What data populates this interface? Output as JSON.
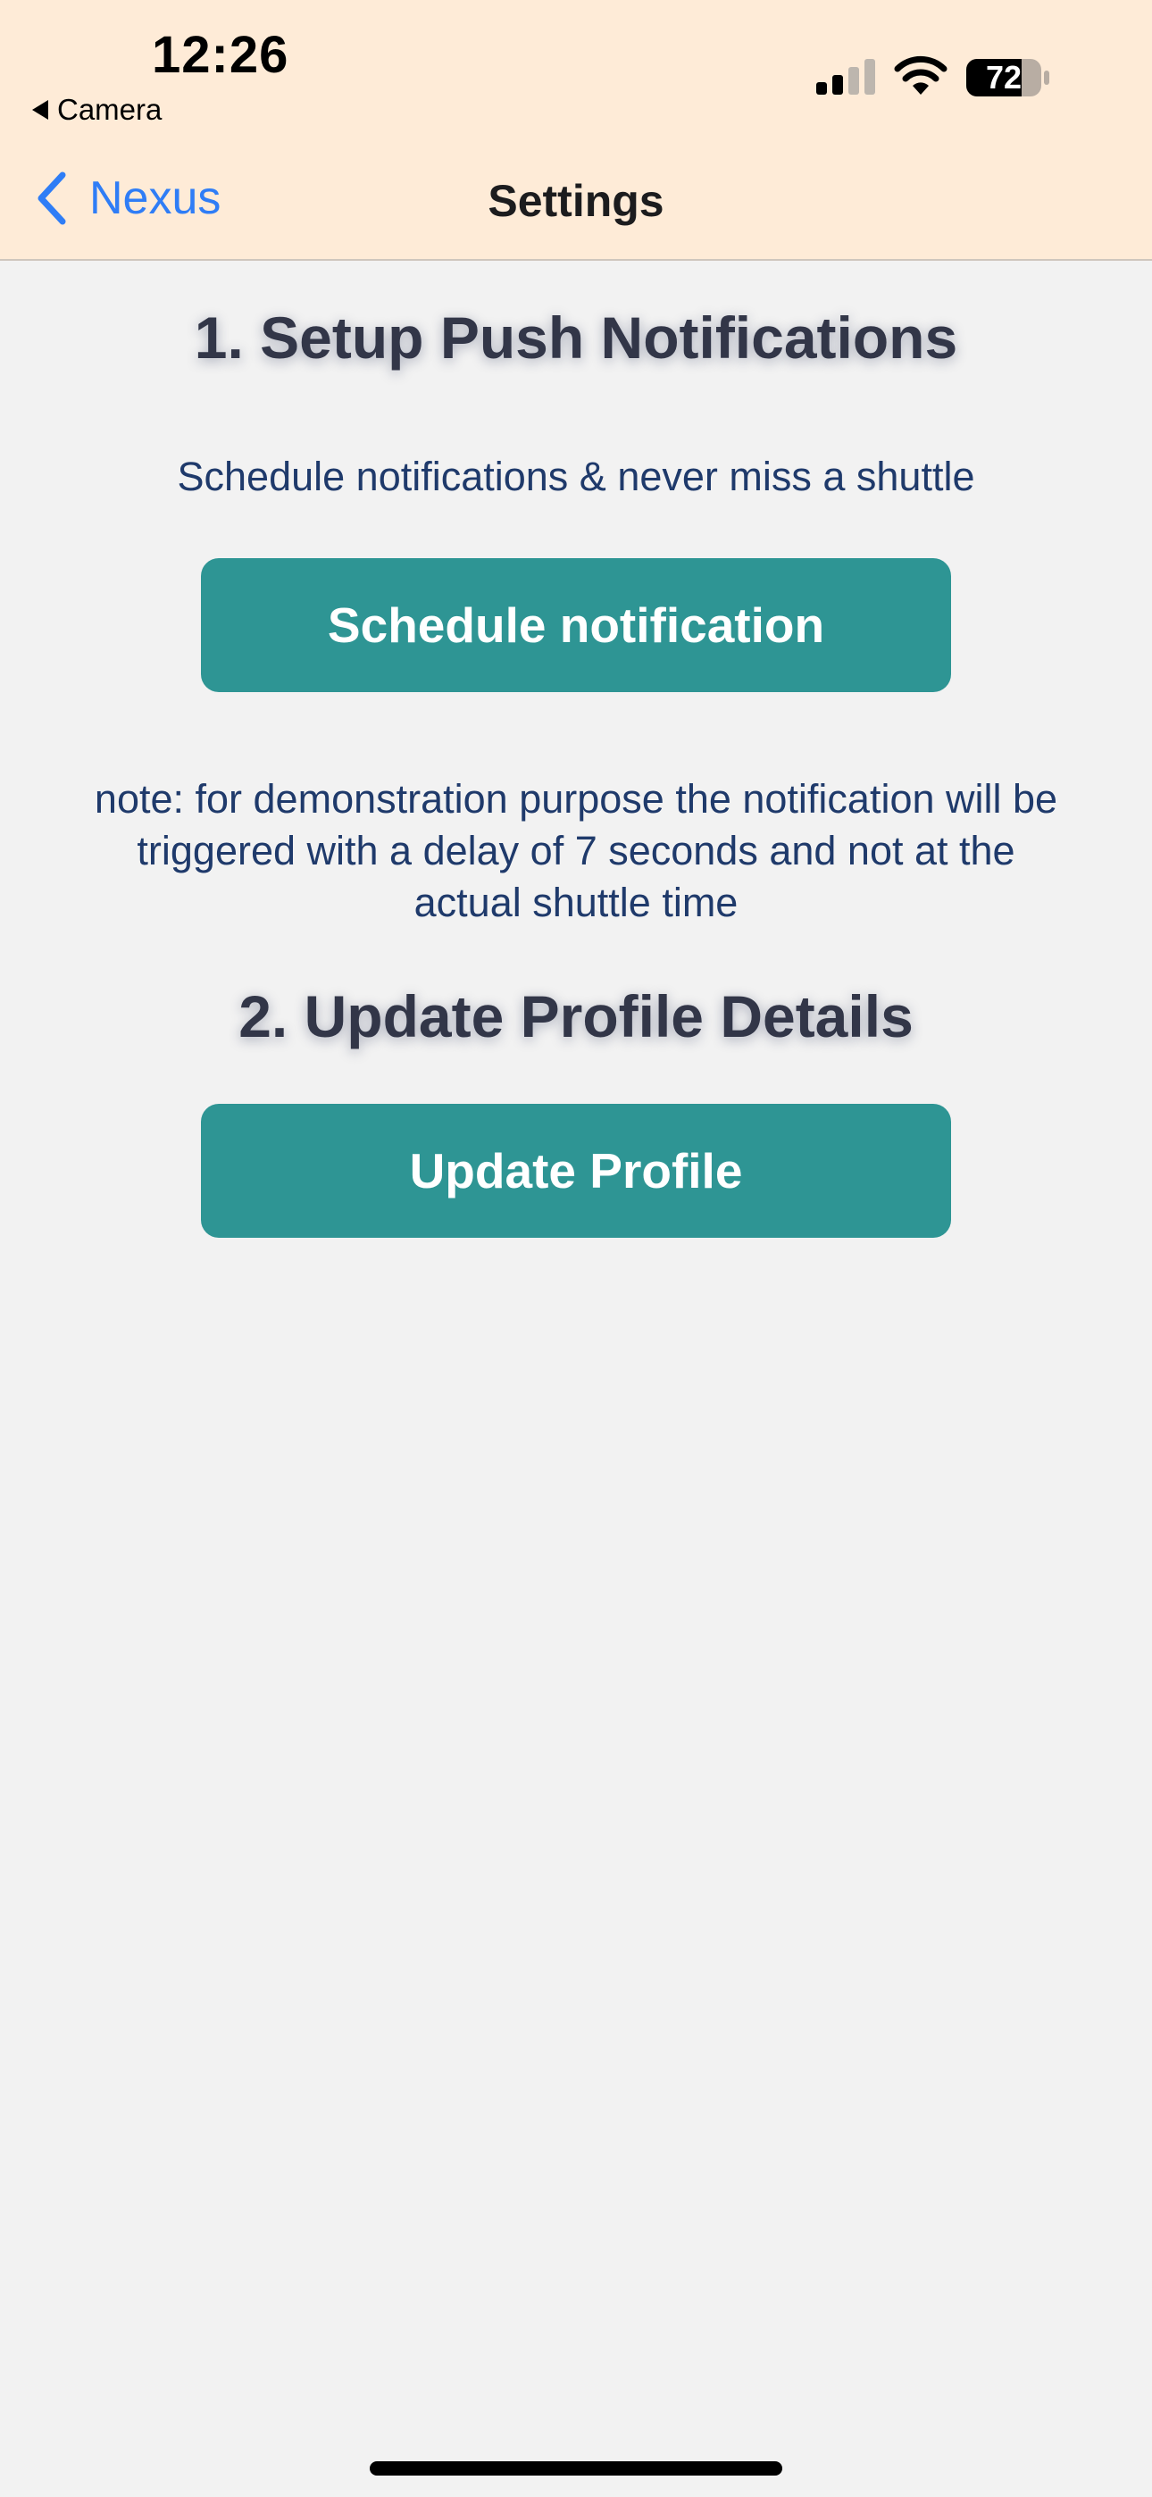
{
  "status_bar": {
    "time": "12:26",
    "back_app_label": "Camera",
    "battery_level": "72",
    "signal_icon": "cellular-signal-icon",
    "wifi_icon": "wifi-icon",
    "battery_icon": "battery-icon"
  },
  "nav": {
    "back_label": "Nexus",
    "title": "Settings",
    "back_icon": "chevron-left-icon"
  },
  "sections": {
    "push": {
      "title": "1. Setup Push Notifications",
      "description": "Schedule notifications & never miss a shuttle",
      "button_label": "Schedule notification",
      "note_line1": "note: for demonstration purpose the notification will be",
      "note_line2": "triggered with a delay of 7 seconds and not at the",
      "note_line3": "actual shuttle time"
    },
    "profile": {
      "title": "2. Update Profile Details",
      "button_label": "Update Profile"
    }
  },
  "colors": {
    "header_bg": "#feebd7",
    "page_bg": "#f2f2f2",
    "button_bg": "#2e9594",
    "accent_link": "#2f7df6",
    "title_text": "#323648",
    "body_text": "#1f3a6b"
  }
}
